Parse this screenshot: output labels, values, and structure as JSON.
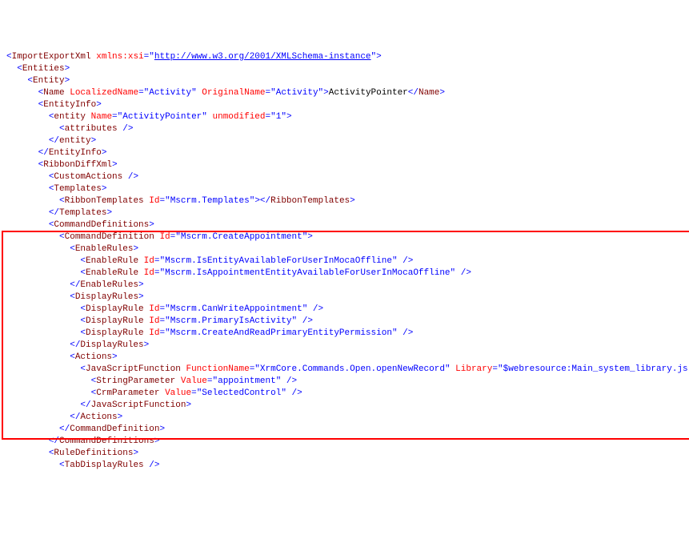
{
  "lines": [
    {
      "indent": 0,
      "segs": [
        {
          "c": "t-punct",
          "t": "<"
        },
        {
          "c": "t-elem",
          "t": "ImportExportXml"
        },
        {
          "c": "t-text",
          "t": " "
        },
        {
          "c": "t-attr",
          "t": "xmlns:xsi"
        },
        {
          "c": "t-punct",
          "t": "=\""
        },
        {
          "c": "t-link",
          "t": "http://www.w3.org/2001/XMLSchema-instance"
        },
        {
          "c": "t-punct",
          "t": "\">"
        }
      ]
    },
    {
      "indent": 1,
      "segs": [
        {
          "c": "t-punct",
          "t": "<"
        },
        {
          "c": "t-elem",
          "t": "Entities"
        },
        {
          "c": "t-punct",
          "t": ">"
        }
      ]
    },
    {
      "indent": 2,
      "segs": [
        {
          "c": "t-punct",
          "t": "<"
        },
        {
          "c": "t-elem",
          "t": "Entity"
        },
        {
          "c": "t-punct",
          "t": ">"
        }
      ]
    },
    {
      "indent": 3,
      "segs": [
        {
          "c": "t-punct",
          "t": "<"
        },
        {
          "c": "t-elem",
          "t": "Name"
        },
        {
          "c": "t-text",
          "t": " "
        },
        {
          "c": "t-attr",
          "t": "LocalizedName"
        },
        {
          "c": "t-punct",
          "t": "="
        },
        {
          "c": "t-punct",
          "t": "\""
        },
        {
          "c": "t-val",
          "t": "Activity"
        },
        {
          "c": "t-punct",
          "t": "\" "
        },
        {
          "c": "t-attr",
          "t": "OriginalName"
        },
        {
          "c": "t-punct",
          "t": "="
        },
        {
          "c": "t-punct",
          "t": "\""
        },
        {
          "c": "t-val",
          "t": "Activity"
        },
        {
          "c": "t-punct",
          "t": "\">"
        },
        {
          "c": "t-text",
          "t": "ActivityPointer"
        },
        {
          "c": "t-punct",
          "t": "</"
        },
        {
          "c": "t-elem",
          "t": "Name"
        },
        {
          "c": "t-punct",
          "t": ">"
        }
      ]
    },
    {
      "indent": 3,
      "segs": [
        {
          "c": "t-punct",
          "t": "<"
        },
        {
          "c": "t-elem",
          "t": "EntityInfo"
        },
        {
          "c": "t-punct",
          "t": ">"
        }
      ]
    },
    {
      "indent": 4,
      "segs": [
        {
          "c": "t-punct",
          "t": "<"
        },
        {
          "c": "t-elem",
          "t": "entity"
        },
        {
          "c": "t-text",
          "t": " "
        },
        {
          "c": "t-attr",
          "t": "Name"
        },
        {
          "c": "t-punct",
          "t": "="
        },
        {
          "c": "t-punct",
          "t": "\""
        },
        {
          "c": "t-val",
          "t": "ActivityPointer"
        },
        {
          "c": "t-punct",
          "t": "\" "
        },
        {
          "c": "t-attr",
          "t": "unmodified"
        },
        {
          "c": "t-punct",
          "t": "="
        },
        {
          "c": "t-punct",
          "t": "\""
        },
        {
          "c": "t-val",
          "t": "1"
        },
        {
          "c": "t-punct",
          "t": "\">"
        }
      ]
    },
    {
      "indent": 5,
      "segs": [
        {
          "c": "t-punct",
          "t": "<"
        },
        {
          "c": "t-elem",
          "t": "attributes"
        },
        {
          "c": "t-punct",
          "t": " />"
        }
      ]
    },
    {
      "indent": 4,
      "segs": [
        {
          "c": "t-punct",
          "t": "</"
        },
        {
          "c": "t-elem",
          "t": "entity"
        },
        {
          "c": "t-punct",
          "t": ">"
        }
      ]
    },
    {
      "indent": 3,
      "segs": [
        {
          "c": "t-punct",
          "t": "</"
        },
        {
          "c": "t-elem",
          "t": "EntityInfo"
        },
        {
          "c": "t-punct",
          "t": ">"
        }
      ]
    },
    {
      "indent": 3,
      "segs": [
        {
          "c": "t-punct",
          "t": "<"
        },
        {
          "c": "t-elem",
          "t": "RibbonDiffXml"
        },
        {
          "c": "t-punct",
          "t": ">"
        }
      ]
    },
    {
      "indent": 4,
      "segs": [
        {
          "c": "t-punct",
          "t": "<"
        },
        {
          "c": "t-elem",
          "t": "CustomActions"
        },
        {
          "c": "t-punct",
          "t": " />"
        }
      ]
    },
    {
      "indent": 4,
      "segs": [
        {
          "c": "t-punct",
          "t": "<"
        },
        {
          "c": "t-elem",
          "t": "Templates"
        },
        {
          "c": "t-punct",
          "t": ">"
        }
      ]
    },
    {
      "indent": 5,
      "segs": [
        {
          "c": "t-punct",
          "t": "<"
        },
        {
          "c": "t-elem",
          "t": "RibbonTemplates"
        },
        {
          "c": "t-text",
          "t": " "
        },
        {
          "c": "t-attr",
          "t": "Id"
        },
        {
          "c": "t-punct",
          "t": "="
        },
        {
          "c": "t-punct",
          "t": "\""
        },
        {
          "c": "t-val",
          "t": "Mscrm.Templates"
        },
        {
          "c": "t-punct",
          "t": "\"></"
        },
        {
          "c": "t-elem",
          "t": "RibbonTemplates"
        },
        {
          "c": "t-punct",
          "t": ">"
        }
      ]
    },
    {
      "indent": 4,
      "segs": [
        {
          "c": "t-punct",
          "t": "</"
        },
        {
          "c": "t-elem",
          "t": "Templates"
        },
        {
          "c": "t-punct",
          "t": ">"
        }
      ]
    },
    {
      "indent": 4,
      "segs": [
        {
          "c": "t-punct",
          "t": "<"
        },
        {
          "c": "t-elem",
          "t": "CommandDefinitions"
        },
        {
          "c": "t-punct",
          "t": ">"
        }
      ]
    },
    {
      "indent": 5,
      "segs": [
        {
          "c": "t-punct",
          "t": "<"
        },
        {
          "c": "t-elem",
          "t": "CommandDefinition"
        },
        {
          "c": "t-text",
          "t": " "
        },
        {
          "c": "t-attr",
          "t": "Id"
        },
        {
          "c": "t-punct",
          "t": "="
        },
        {
          "c": "t-punct",
          "t": "\""
        },
        {
          "c": "t-val",
          "t": "Mscrm.CreateAppointment"
        },
        {
          "c": "t-punct",
          "t": "\">"
        }
      ]
    },
    {
      "indent": 6,
      "segs": [
        {
          "c": "t-punct",
          "t": "<"
        },
        {
          "c": "t-elem",
          "t": "EnableRules"
        },
        {
          "c": "t-punct",
          "t": ">"
        }
      ]
    },
    {
      "indent": 7,
      "segs": [
        {
          "c": "t-punct",
          "t": "<"
        },
        {
          "c": "t-elem",
          "t": "EnableRule"
        },
        {
          "c": "t-text",
          "t": " "
        },
        {
          "c": "t-attr",
          "t": "Id"
        },
        {
          "c": "t-punct",
          "t": "="
        },
        {
          "c": "t-punct",
          "t": "\""
        },
        {
          "c": "t-val",
          "t": "Mscrm.IsEntityAvailableForUserInMocaOffline"
        },
        {
          "c": "t-punct",
          "t": "\" />"
        }
      ]
    },
    {
      "indent": 7,
      "segs": [
        {
          "c": "t-punct",
          "t": "<"
        },
        {
          "c": "t-elem",
          "t": "EnableRule"
        },
        {
          "c": "t-text",
          "t": " "
        },
        {
          "c": "t-attr",
          "t": "Id"
        },
        {
          "c": "t-punct",
          "t": "="
        },
        {
          "c": "t-punct",
          "t": "\""
        },
        {
          "c": "t-val",
          "t": "Mscrm.IsAppointmentEntityAvailableForUserInMocaOffline"
        },
        {
          "c": "t-punct",
          "t": "\" />"
        }
      ]
    },
    {
      "indent": 6,
      "segs": [
        {
          "c": "t-punct",
          "t": "</"
        },
        {
          "c": "t-elem",
          "t": "EnableRules"
        },
        {
          "c": "t-punct",
          "t": ">"
        }
      ]
    },
    {
      "indent": 6,
      "segs": [
        {
          "c": "t-punct",
          "t": "<"
        },
        {
          "c": "t-elem",
          "t": "DisplayRules"
        },
        {
          "c": "t-punct",
          "t": ">"
        }
      ]
    },
    {
      "indent": 7,
      "segs": [
        {
          "c": "t-punct",
          "t": "<"
        },
        {
          "c": "t-elem",
          "t": "DisplayRule"
        },
        {
          "c": "t-text",
          "t": " "
        },
        {
          "c": "t-attr",
          "t": "Id"
        },
        {
          "c": "t-punct",
          "t": "="
        },
        {
          "c": "t-punct",
          "t": "\""
        },
        {
          "c": "t-val",
          "t": "Mscrm.CanWriteAppointment"
        },
        {
          "c": "t-punct",
          "t": "\" />"
        }
      ]
    },
    {
      "indent": 7,
      "segs": [
        {
          "c": "t-punct",
          "t": "<"
        },
        {
          "c": "t-elem",
          "t": "DisplayRule"
        },
        {
          "c": "t-text",
          "t": " "
        },
        {
          "c": "t-attr",
          "t": "Id"
        },
        {
          "c": "t-punct",
          "t": "="
        },
        {
          "c": "t-punct",
          "t": "\""
        },
        {
          "c": "t-val",
          "t": "Mscrm.PrimaryIsActivity"
        },
        {
          "c": "t-punct",
          "t": "\" />"
        }
      ]
    },
    {
      "indent": 7,
      "segs": [
        {
          "c": "t-punct",
          "t": "<"
        },
        {
          "c": "t-elem",
          "t": "DisplayRule"
        },
        {
          "c": "t-text",
          "t": " "
        },
        {
          "c": "t-attr",
          "t": "Id"
        },
        {
          "c": "t-punct",
          "t": "="
        },
        {
          "c": "t-punct",
          "t": "\""
        },
        {
          "c": "t-val",
          "t": "Mscrm.CreateAndReadPrimaryEntityPermission"
        },
        {
          "c": "t-punct",
          "t": "\" />"
        }
      ]
    },
    {
      "indent": 6,
      "segs": [
        {
          "c": "t-punct",
          "t": "</"
        },
        {
          "c": "t-elem",
          "t": "DisplayRules"
        },
        {
          "c": "t-punct",
          "t": ">"
        }
      ]
    },
    {
      "indent": 6,
      "segs": [
        {
          "c": "t-punct",
          "t": "<"
        },
        {
          "c": "t-elem",
          "t": "Actions"
        },
        {
          "c": "t-punct",
          "t": ">"
        }
      ]
    },
    {
      "indent": 7,
      "segs": [
        {
          "c": "t-punct",
          "t": "<"
        },
        {
          "c": "t-elem",
          "t": "JavaScriptFunction"
        },
        {
          "c": "t-text",
          "t": " "
        },
        {
          "c": "t-attr",
          "t": "FunctionName"
        },
        {
          "c": "t-punct",
          "t": "="
        },
        {
          "c": "t-punct",
          "t": "\""
        },
        {
          "c": "t-val",
          "t": "XrmCore.Commands.Open.openNewRecord"
        },
        {
          "c": "t-punct",
          "t": "\" "
        },
        {
          "c": "t-attr",
          "t": "Library"
        },
        {
          "c": "t-punct",
          "t": "="
        },
        {
          "c": "t-punct",
          "t": "\""
        },
        {
          "c": "t-val",
          "t": "$webresource:Main_system_library.js"
        },
        {
          "c": "t-punct",
          "t": "\">"
        }
      ]
    },
    {
      "indent": 8,
      "segs": [
        {
          "c": "t-punct",
          "t": "<"
        },
        {
          "c": "t-elem",
          "t": "StringParameter"
        },
        {
          "c": "t-text",
          "t": " "
        },
        {
          "c": "t-attr",
          "t": "Value"
        },
        {
          "c": "t-punct",
          "t": "="
        },
        {
          "c": "t-punct",
          "t": "\""
        },
        {
          "c": "t-val",
          "t": "appointment"
        },
        {
          "c": "t-punct",
          "t": "\" />"
        }
      ]
    },
    {
      "indent": 8,
      "segs": [
        {
          "c": "t-punct",
          "t": "<"
        },
        {
          "c": "t-elem",
          "t": "CrmParameter"
        },
        {
          "c": "t-text",
          "t": " "
        },
        {
          "c": "t-attr",
          "t": "Value"
        },
        {
          "c": "t-punct",
          "t": "="
        },
        {
          "c": "t-punct",
          "t": "\""
        },
        {
          "c": "t-val",
          "t": "SelectedControl"
        },
        {
          "c": "t-punct",
          "t": "\" />"
        }
      ]
    },
    {
      "indent": 7,
      "segs": [
        {
          "c": "t-punct",
          "t": "</"
        },
        {
          "c": "t-elem",
          "t": "JavaScriptFunction"
        },
        {
          "c": "t-punct",
          "t": ">"
        }
      ]
    },
    {
      "indent": 6,
      "segs": [
        {
          "c": "t-punct",
          "t": "</"
        },
        {
          "c": "t-elem",
          "t": "Actions"
        },
        {
          "c": "t-punct",
          "t": ">"
        }
      ]
    },
    {
      "indent": 5,
      "segs": [
        {
          "c": "t-punct",
          "t": "</"
        },
        {
          "c": "t-elem",
          "t": "CommandDefinition"
        },
        {
          "c": "t-punct",
          "t": ">"
        }
      ]
    },
    {
      "indent": 4,
      "segs": [
        {
          "c": "t-punct",
          "t": "</"
        },
        {
          "c": "t-elem",
          "t": "CommandDefinitions"
        },
        {
          "c": "t-punct",
          "t": ">"
        }
      ]
    },
    {
      "indent": 4,
      "segs": [
        {
          "c": "t-punct",
          "t": "<"
        },
        {
          "c": "t-elem",
          "t": "RuleDefinitions"
        },
        {
          "c": "t-punct",
          "t": ">"
        }
      ]
    },
    {
      "indent": 5,
      "segs": [
        {
          "c": "t-punct",
          "t": "<"
        },
        {
          "c": "t-elem",
          "t": "TabDisplayRules"
        },
        {
          "c": "t-punct",
          "t": " />"
        }
      ]
    }
  ],
  "highlight": {
    "firstLine": 15,
    "lastLine": 31
  }
}
